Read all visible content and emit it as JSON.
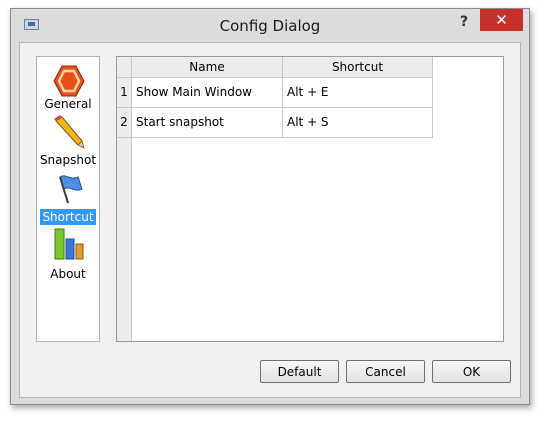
{
  "window": {
    "title": "Config Dialog",
    "help_label": "?",
    "close_label": "✕"
  },
  "sidebar": {
    "items": [
      {
        "label": "General",
        "icon": "hexagon-icon",
        "selected": false
      },
      {
        "label": "Snapshot",
        "icon": "pencil-icon",
        "selected": false
      },
      {
        "label": "Shortcut",
        "icon": "flag-icon",
        "selected": true
      },
      {
        "label": "About",
        "icon": "bar-chart-icon",
        "selected": false
      }
    ]
  },
  "table": {
    "columns": [
      "Name",
      "Shortcut"
    ],
    "rows": [
      {
        "num": "1",
        "name": "Show Main Window",
        "shortcut": "Alt + E"
      },
      {
        "num": "2",
        "name": "Start snapshot",
        "shortcut": "Alt + S"
      }
    ]
  },
  "buttons": {
    "default": "Default",
    "cancel": "Cancel",
    "ok": "OK"
  },
  "colors": {
    "selection": "#3399ff",
    "close": "#c7312b"
  }
}
